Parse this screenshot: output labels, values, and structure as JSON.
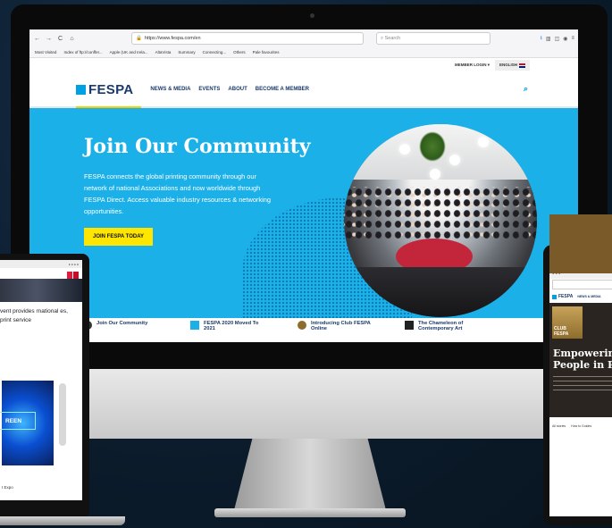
{
  "browser": {
    "url": "https://www.fespa.com/en",
    "search_placeholder": "Search",
    "nav": {
      "back": "←",
      "forward": "→",
      "reload": "C",
      "home": "⌂"
    },
    "toolbar_icons": [
      "download-icon",
      "library-icon",
      "sidebar-icon",
      "account-icon",
      "menu-icon"
    ],
    "bookmarks": [
      "Most Visited",
      "Index of ftp://conffer...",
      "Apple (UK and Irela...",
      "AltaVista",
      "Summary",
      "Connecting...",
      "Others",
      "Pale favourites"
    ]
  },
  "site": {
    "util": {
      "member_login": "MEMBER LOGIN ▾",
      "language": "ENGLISH"
    },
    "logo": "FESPA",
    "menu": [
      "NEWS & MEDIA",
      "EVENTS",
      "ABOUT",
      "BECOME A MEMBER"
    ],
    "hero": {
      "title": "Join Our Community",
      "text": "FESPA connects the global printing community through our network of national Associations and now worldwide through FESPA Direct. Access valuable industry resources & networking opportunities.",
      "cta": "JOIN FESPA TODAY"
    },
    "teasers": [
      "Join Our Community",
      "FESPA 2020 Moved To 2021",
      "Introducing Club FESPA Online",
      "The Chameleon of Contemporary Art"
    ]
  },
  "laptop": {
    "text": "vent provides rnational es, print service",
    "promo_label": "REEN",
    "footer": "t Expo"
  },
  "tablet": {
    "logo": "FESPA",
    "menu": "NEWS & MEDIA",
    "badge": "CLUB FESPA",
    "title_line1": "Empowering",
    "title_line2": "People in Pr",
    "tabs": [
      "All stories",
      "How to Guides"
    ]
  },
  "colors": {
    "brand_blue": "#1cb0e8",
    "navy": "#1a3a6e",
    "cta_yellow": "#ffe600"
  }
}
